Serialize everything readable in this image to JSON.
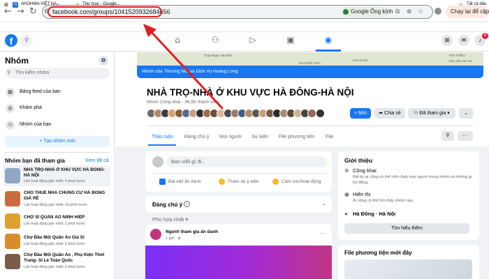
{
  "browser": {
    "url": "facebook.com/groups/1041520932684656",
    "lens_chip": "Google Ống kính",
    "relaunch": "Chạy lại để cập nhật",
    "bookmarks": {
      "ahohwa": "AHOHWA VIỆT NA...",
      "google": "Thư mục - Google...",
      "all": "Tất cả dấu"
    }
  },
  "fb": {
    "logo": "f",
    "notifications_count": "6"
  },
  "sidebar": {
    "title": "Nhóm",
    "search_placeholder": "Tìm kiếm nhóm",
    "items": [
      {
        "label": "Bảng feed của bạn",
        "icon": "feed-icon"
      },
      {
        "label": "Khám phá",
        "icon": "compass-icon"
      },
      {
        "label": "Nhóm của bạn",
        "icon": "groups-icon"
      }
    ],
    "create_label": "+ Tạo nhóm mới",
    "joined_title": "Nhóm bạn đã tham gia",
    "see_all": "Xem tất cả",
    "groups": [
      {
        "name": "NHÀ TRỌ-NHÀ Ở KHU VỰC HÀ ĐÔNG-HÀ NỘI",
        "time": "Lần hoạt động gần nhất: 4 phút trước",
        "color": "#8fa7c4"
      },
      {
        "name": "CHO THUÊ NHÀ CHUNG CƯ HÀ ĐÔNG GIÁ RẺ",
        "time": "Lần hoạt động gần nhất: 16 phút trước",
        "color": "#c96b3c"
      },
      {
        "name": "CHỢ SỈ QUẦN ÁO NINH HIỆP",
        "time": "Lần hoạt động gần nhất: 2 phút trước",
        "color": "#e0a030"
      },
      {
        "name": "Chợ Đầu Mối Quần Áo Giá Sỉ",
        "time": "Lần hoạt động gần nhất: 2 phút trước",
        "color": "#d98c2a"
      },
      {
        "name": "Chợ Đầu Mối Quần Áo , Phụ Kiện Thời Trang- Sỉ Lẻ Toàn Quốc",
        "time": "Lần hoạt động gần nhất: 2 phút trước",
        "color": "#7a5c4a"
      }
    ]
  },
  "group": {
    "cover_text": "Nhóm của Thương Mại và Dịch Vụ Hoàng Long",
    "map_labels": [
      "Chùa Ngọc Hà Bình",
      "NGUYỄN TRÃI",
      "VĂN PHÚC",
      "TÂN TRIỀU",
      "Cầu Văn Kim Sa"
    ],
    "title": "NHÀ TRỌ-NHÀ Ở KHU VỰC HÀ ĐÔNG-HÀ NỘI",
    "meta": "Nhóm Công khai · 36,5K thành viên",
    "invite": "+ Mời",
    "share": "Chia sẻ",
    "joined": "Đã tham gia",
    "tabs": [
      "Thảo luận",
      "Đáng chú ý",
      "Mọi người",
      "Sự kiện",
      "File phương tiện",
      "File"
    ]
  },
  "composer": {
    "placeholder": "Bạn viết gì đi...",
    "actions": [
      "Bài viết ẩn danh",
      "Thăm dò ý kiến",
      "Cảm xúc/hoạt động"
    ]
  },
  "feed": {
    "featured": "Đáng chú ý",
    "sort": "Phù hợp nhất",
    "post_author": "Người tham gia ẩn danh",
    "post_time": "1 giờ · ⊕"
  },
  "about": {
    "title": "Giới thiệu",
    "public_head": "Công khai",
    "public_sub": "Bất kỳ ai cũng có thể nhìn thấy mọi người trong nhóm và những gì họ đăng.",
    "visible_head": "Hiển thị",
    "visible_sub": "Ai cũng có thể tìm thấy nhóm này.",
    "location": "Hà Đông · Hà Nội",
    "learn_more": "Tìm hiểu thêm"
  },
  "media": {
    "title": "File phương tiện mới đây"
  },
  "colors": {
    "fb_blue": "#1877f2",
    "annotation_red": "#e02020"
  }
}
